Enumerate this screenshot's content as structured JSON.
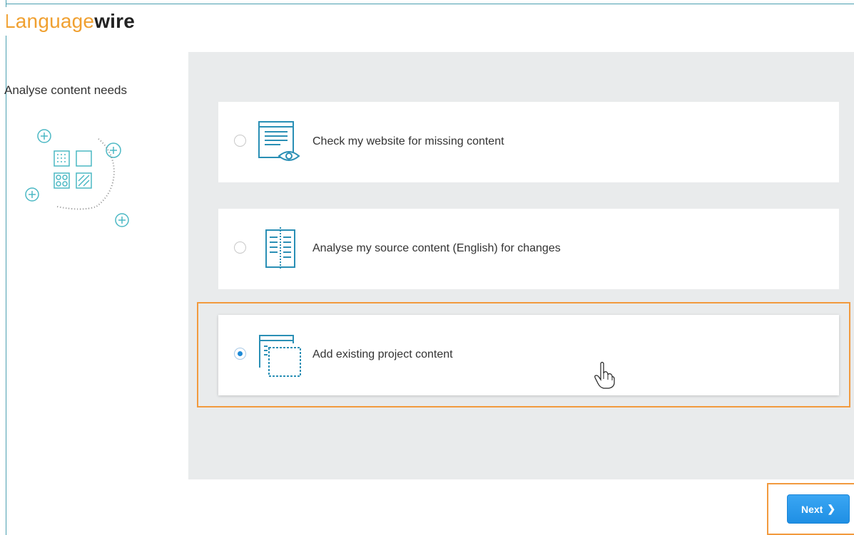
{
  "app": {
    "logo_part1": "Language",
    "logo_part2": "wire"
  },
  "sidebar": {
    "title": "Analyse content needs",
    "illustration_icon": "content-grid-plus-icon"
  },
  "options": [
    {
      "label": "Check my website for missing content",
      "icon": "website-eye-icon",
      "selected": false
    },
    {
      "label": "Analyse my source content (English) for changes",
      "icon": "compare-document-icon",
      "selected": false
    },
    {
      "label": "Add existing project content",
      "icon": "add-project-content-icon",
      "selected": true
    }
  ],
  "footer": {
    "next_label": "Next",
    "next_icon": "chevron-right-icon"
  },
  "colors": {
    "accent": "#2a8fb5",
    "button": "#1f8fe4",
    "highlight": "#f29a3e",
    "panel": "#e9ebec",
    "logo_orange": "#f0a030"
  }
}
